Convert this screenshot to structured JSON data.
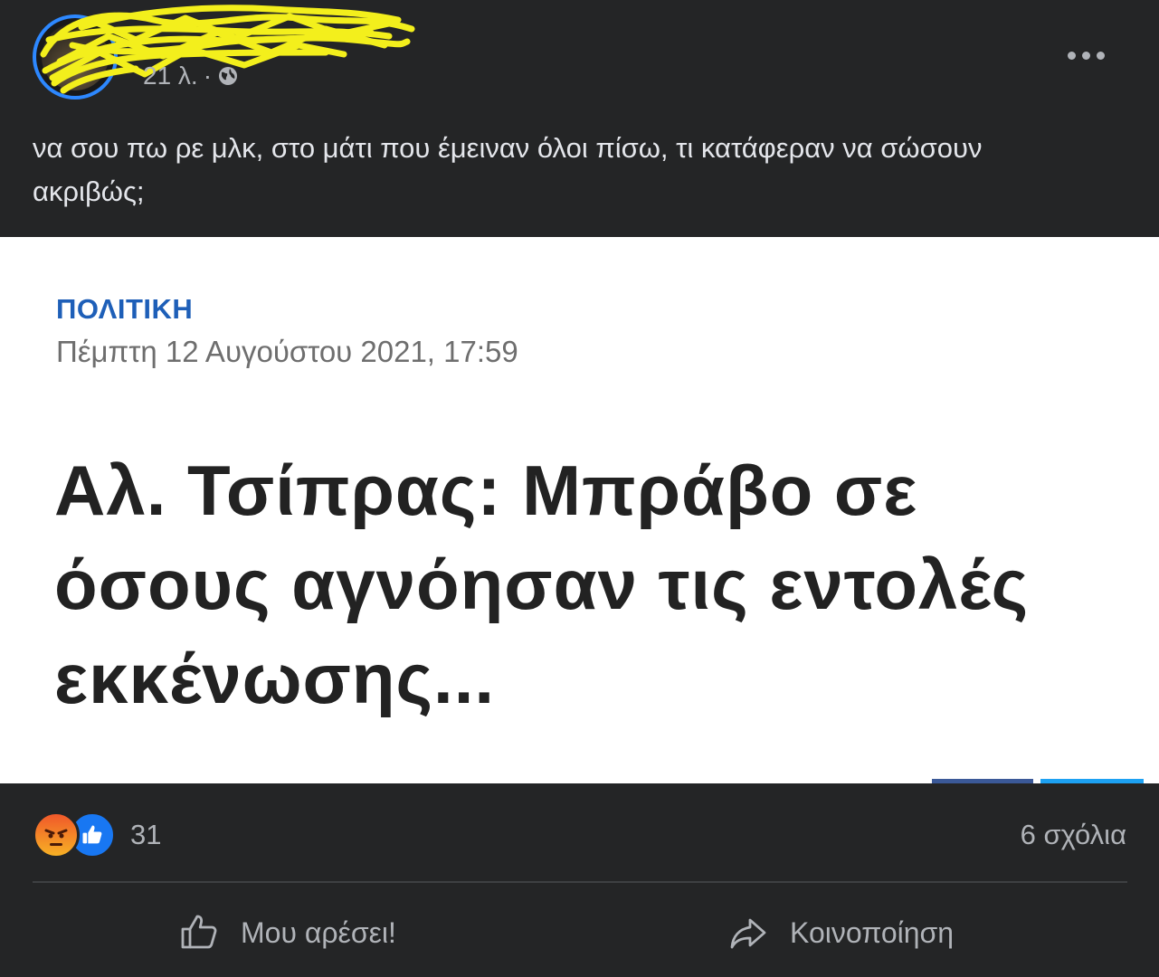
{
  "post": {
    "time": "21 λ.",
    "separator": "·",
    "text": "να σου πω ρε μλκ, στο μάτι που έμειναν όλοι πίσω, τι κατάφεραν να σώσουν ακριβώς;"
  },
  "article": {
    "category": "ΠΟΛΙΤΙΚΗ",
    "date": "Πέμπτη 12 Αυγούστου 2021, 17:59",
    "headline": "Αλ. Τσίπρας: Μπράβο σε όσους αγνόησαν τις εντολές εκκένωσης..."
  },
  "footer": {
    "reaction_count": "31",
    "reaction_icons": [
      "angry-icon",
      "like-icon"
    ],
    "comments": "6 σχόλια",
    "like_label": "Μου αρέσει!",
    "share_label": "Κοινοποίηση"
  },
  "colors": {
    "background": "#242526",
    "category": "#1e5fb8",
    "accent": "#2d88ff",
    "redaction": "#f3ef1c"
  }
}
